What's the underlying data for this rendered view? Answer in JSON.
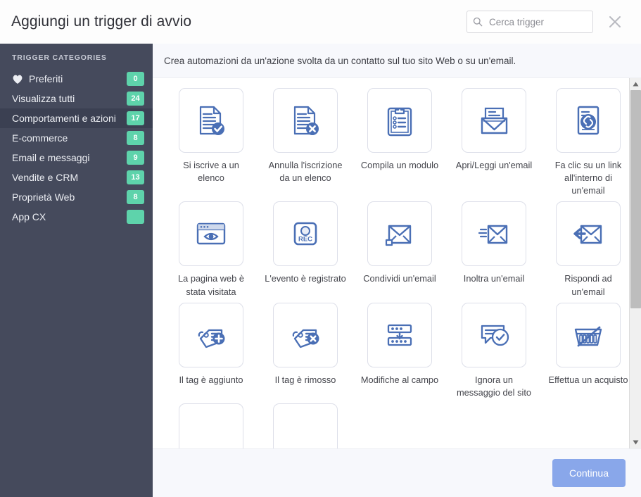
{
  "header": {
    "title": "Aggiungi un trigger di avvio",
    "search_placeholder": "Cerca trigger",
    "search_value": "",
    "search_icon": "search-icon",
    "close_icon": "close-icon"
  },
  "sidebar": {
    "title": "TRIGGER CATEGORIES",
    "background_color": "#454a5c",
    "selected_color": "#3b4052",
    "badge_color": "#5ed3ab",
    "items": [
      {
        "label": "Preferiti",
        "badge": "0",
        "icon": "heart-icon",
        "selected": false
      },
      {
        "label": "Visualizza tutti",
        "badge": "24",
        "icon": "",
        "selected": false
      },
      {
        "label": "Comportamenti e azioni",
        "badge": "17",
        "icon": "",
        "selected": true
      },
      {
        "label": "E-commerce",
        "badge": "8",
        "icon": "",
        "selected": false
      },
      {
        "label": "Email e messaggi",
        "badge": "9",
        "icon": "",
        "selected": false
      },
      {
        "label": "Vendite e CRM",
        "badge": "13",
        "icon": "",
        "selected": false
      },
      {
        "label": "Proprietà Web",
        "badge": "8",
        "icon": "",
        "selected": false
      },
      {
        "label": "App CX",
        "badge": "",
        "icon": "",
        "selected": false
      }
    ]
  },
  "main": {
    "description": "Crea automazioni da un'azione svolta da un contatto sul tuo sito Web o su un'email.",
    "accent_color": "#4a6fb5",
    "cards": [
      {
        "label": "Si iscrive a un elenco",
        "icon": "document-check-icon"
      },
      {
        "label": "Annulla l'iscrizione da un elenco",
        "icon": "document-x-icon"
      },
      {
        "label": "Compila un modulo",
        "icon": "clipboard-list-icon"
      },
      {
        "label": "Apri/Leggi un'email",
        "icon": "open-envelope-icon"
      },
      {
        "label": "Fa clic su un link all'interno di un'email",
        "icon": "document-link-icon"
      },
      {
        "label": "La pagina web è stata visitata",
        "icon": "browser-eye-icon"
      },
      {
        "label": "L'evento è registrato",
        "icon": "rec-button-icon"
      },
      {
        "label": "Condividi un'email",
        "icon": "share-envelope-icon"
      },
      {
        "label": "Inoltra un'email",
        "icon": "forward-envelope-icon"
      },
      {
        "label": "Rispondi ad un'email",
        "icon": "reply-envelope-icon"
      },
      {
        "label": "Il tag è aggiunto",
        "icon": "tag-plus-icon"
      },
      {
        "label": "Il tag è rimosso",
        "icon": "tag-x-icon"
      },
      {
        "label": "Modifiche al campo",
        "icon": "field-change-icon"
      },
      {
        "label": "Ignora un messaggio del sito",
        "icon": "chat-check-icon"
      },
      {
        "label": "Effettua un acquisto",
        "icon": "shopping-basket-icon"
      },
      {
        "label": "",
        "icon": ""
      },
      {
        "label": "",
        "icon": ""
      }
    ]
  },
  "scrollbar": {
    "up_icon": "scroll-up-arrow-icon",
    "down_icon": "scroll-down-arrow-icon",
    "thumb_position_percent": 0
  },
  "footer": {
    "continue_label": "Continua",
    "continue_color": "#89a7ea"
  }
}
